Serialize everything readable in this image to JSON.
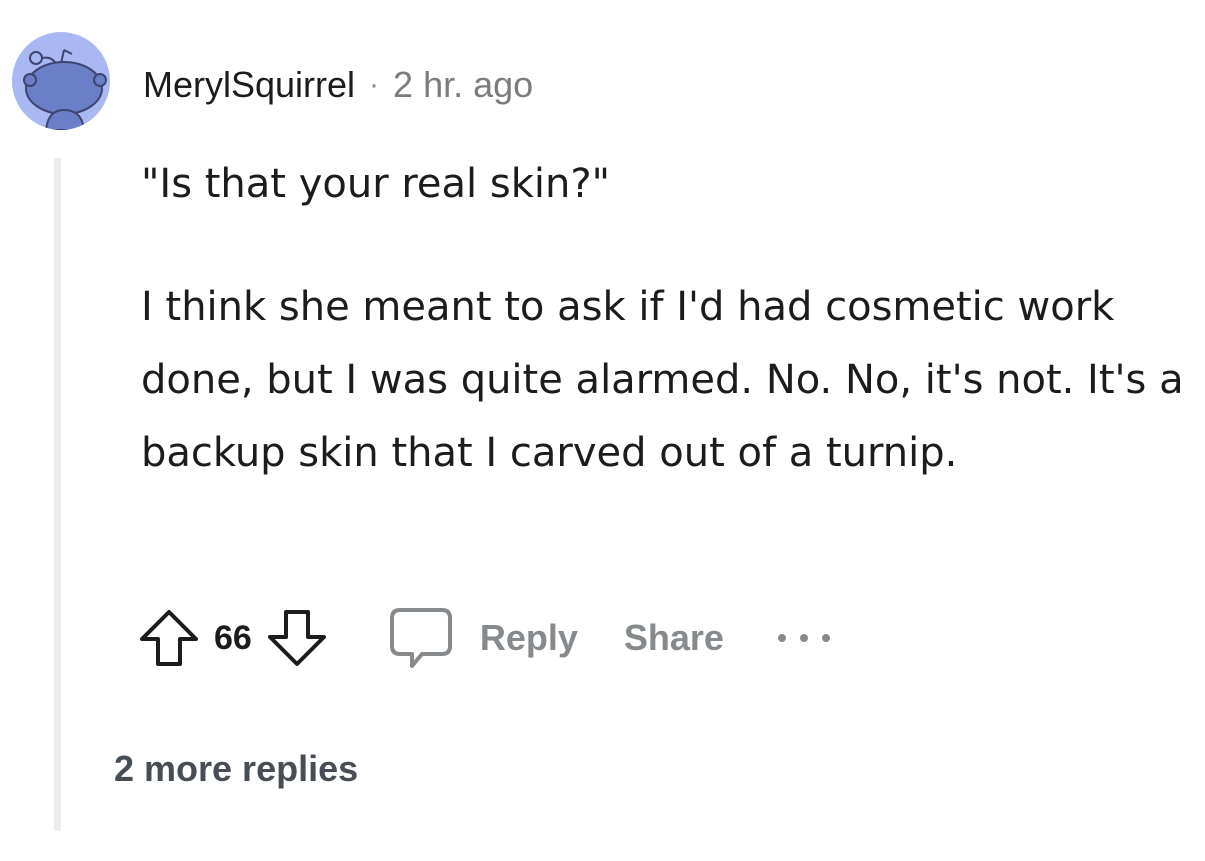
{
  "comment": {
    "username": "MerylSquirrel",
    "separator": "·",
    "time": "2 hr. ago",
    "paragraphs": [
      "\"Is that your real skin?\"",
      "I think she meant to ask if I'd had cosmetic work done, but I was quite alarmed. No. No, it's not. It's a backup skin that I carved out of a turnip."
    ],
    "vote_count": "66",
    "reply_label": "Reply",
    "share_label": "Share",
    "more_replies_label": "2 more replies"
  },
  "icons": {
    "avatar": "snoo-avatar-icon",
    "upvote": "upvote-arrow-icon",
    "downvote": "downvote-arrow-icon",
    "comment": "comment-bubble-icon",
    "more": "more-options-icon"
  },
  "colors": {
    "avatar_bg": "#a9b8f2",
    "avatar_figure": "#6b7fc9",
    "muted_text": "#878a8c",
    "thread_line": "#ececec"
  }
}
